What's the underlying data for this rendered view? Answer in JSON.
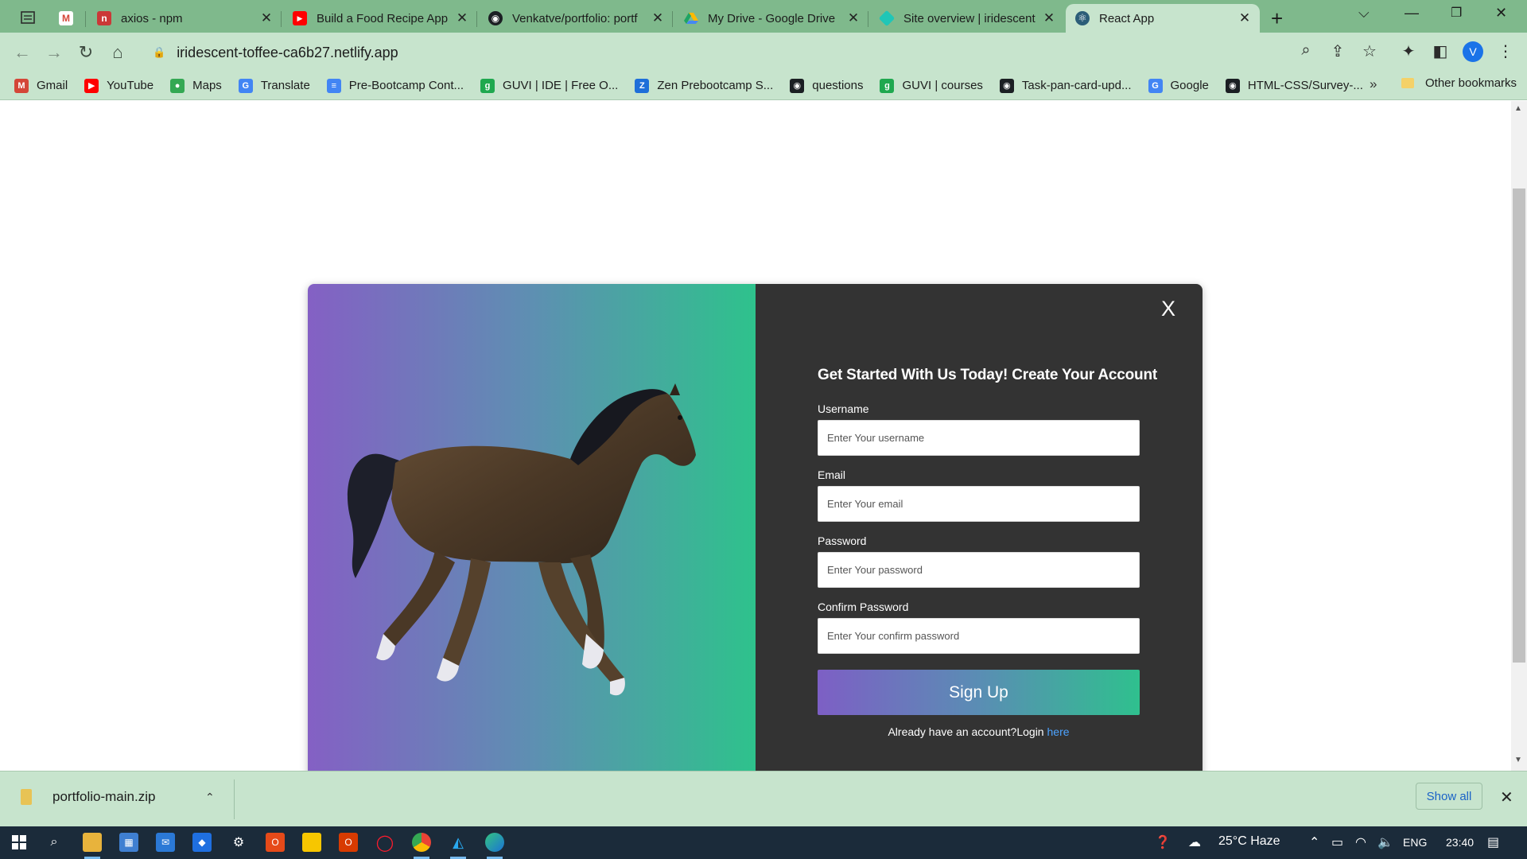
{
  "browser": {
    "tabs": [
      {
        "title": "",
        "icon": "gmail-icon",
        "color": "#d44638"
      },
      {
        "title": "axios - npm",
        "icon": "npm-icon",
        "color": "#cb3837"
      },
      {
        "title": "Build a Food Recipe App",
        "icon": "youtube-icon",
        "color": "#ff0000"
      },
      {
        "title": "Venkatve/portfolio: portf",
        "icon": "github-icon",
        "color": "#1b1f23"
      },
      {
        "title": "My Drive - Google Drive",
        "icon": "drive-icon",
        "color": "#1fa463"
      },
      {
        "title": "Site overview | iridescent",
        "icon": "netlify-icon",
        "color": "#20c6b7"
      },
      {
        "title": "React App",
        "icon": "react-icon",
        "color": "#2b5d78"
      }
    ],
    "url": "iridescent-toffee-ca6b27.netlify.app",
    "profile_initial": "V",
    "bookmarks": [
      {
        "label": "Gmail",
        "icon": "gmail-icon",
        "color": "#d44638",
        "glyph": "M"
      },
      {
        "label": "YouTube",
        "icon": "youtube-icon",
        "color": "#ff0000",
        "glyph": "▶"
      },
      {
        "label": "Maps",
        "icon": "maps-icon",
        "color": "#34a853",
        "glyph": "●"
      },
      {
        "label": "Translate",
        "icon": "translate-icon",
        "color": "#4285f4",
        "glyph": "G"
      },
      {
        "label": "Pre-Bootcamp Cont...",
        "icon": "docs-icon",
        "color": "#4285f4",
        "glyph": "≡"
      },
      {
        "label": "GUVI | IDE | Free O...",
        "icon": "guvi-icon",
        "color": "#1fa84f",
        "glyph": "g"
      },
      {
        "label": "Zen Prebootcamp S...",
        "icon": "zen-icon",
        "color": "#1e6fd9",
        "glyph": "Z"
      },
      {
        "label": "questions",
        "icon": "github-icon",
        "color": "#1b1f23",
        "glyph": "◉"
      },
      {
        "label": "GUVI | courses",
        "icon": "guvi-icon",
        "color": "#1fa84f",
        "glyph": "g"
      },
      {
        "label": "Task-pan-card-upd...",
        "icon": "github-icon",
        "color": "#1b1f23",
        "glyph": "◉"
      },
      {
        "label": "Google",
        "icon": "google-icon",
        "color": "#4285f4",
        "glyph": "G"
      },
      {
        "label": "HTML-CSS/Survey-...",
        "icon": "github-icon",
        "color": "#1b1f23",
        "glyph": "◉"
      }
    ],
    "more_bookmarks": "»",
    "other_bookmarks": "Other bookmarks"
  },
  "modal": {
    "close_label": "X",
    "title": "Get Started With Us Today! Create Your Account",
    "fields": [
      {
        "label": "Username",
        "placeholder": "Enter Your username",
        "value": ""
      },
      {
        "label": "Email",
        "placeholder": "Enter Your email",
        "value": ""
      },
      {
        "label": "Password",
        "placeholder": "Enter Your password",
        "value": ""
      },
      {
        "label": "Confirm Password",
        "placeholder": "Enter Your confirm password",
        "value": ""
      }
    ],
    "signup_label": "Sign Up",
    "login_prompt": "Already have an account?Login ",
    "login_link": "here"
  },
  "downloads": {
    "file_name": "portfolio-main.zip",
    "show_all": "Show all"
  },
  "taskbar": {
    "weather": "25°C Haze",
    "language": "ENG",
    "time": "23:40"
  },
  "colors": {
    "gradient_start": "#8460c4",
    "gradient_end": "#2ec28c",
    "panel_dark": "#333333",
    "link": "#4da3ff"
  }
}
